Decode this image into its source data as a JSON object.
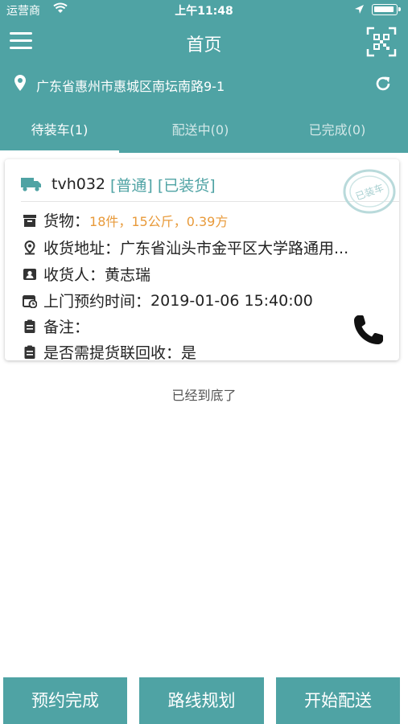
{
  "status_bar": {
    "carrier": "运营商",
    "time": "上午11:48"
  },
  "navbar": {
    "title": "首页"
  },
  "address_bar": {
    "address": "广东省惠州市惠城区南坛南路9-1"
  },
  "tabs": [
    {
      "label": "待装车(1)",
      "active": true
    },
    {
      "label": "配送中(0)",
      "active": false
    },
    {
      "label": "已完成(0)",
      "active": false
    }
  ],
  "order_card": {
    "code": "tvh032",
    "tag_type": "[普通]",
    "tag_status": "[已装货]",
    "stamp_text": "已装车",
    "goods_label": "货物：",
    "goods_value": "18件，15公斤，0.39方",
    "address_label": "收货地址：",
    "address_value": "广东省汕头市金平区大学路通用...",
    "receiver_label": "收货人：",
    "receiver_value": "黄志瑞",
    "appointment_label": "上门预约时间：",
    "appointment_value": "2019-01-06 15:40:00",
    "remark_label": "备注：",
    "remark_value": "",
    "recycle_label": "是否需提货联回收：",
    "recycle_value": "是"
  },
  "end_text": "已经到底了",
  "bottom_buttons": [
    "预约完成",
    "路线规划",
    "开始配送"
  ],
  "colors": {
    "primary": "#4fa3a4",
    "accent_orange": "#e89a3a"
  }
}
